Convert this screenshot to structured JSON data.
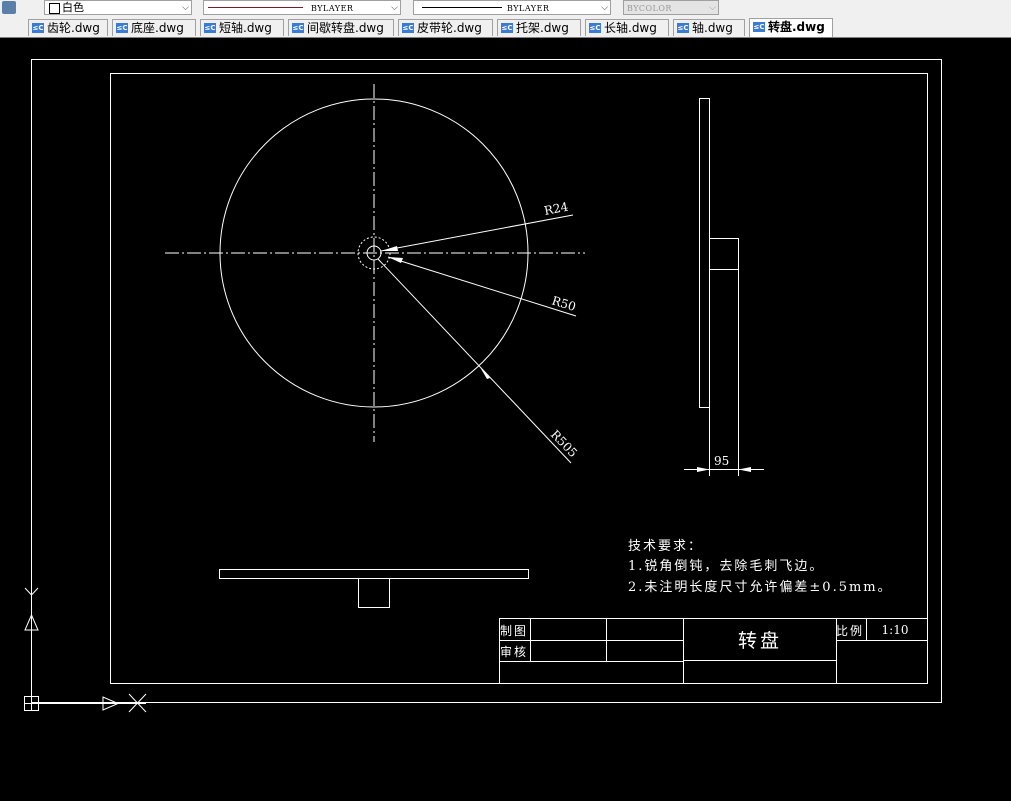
{
  "toolbar": {
    "color_value": "白色",
    "linetype_value": "BYLAYER",
    "lineweight_value": "BYLAYER",
    "plotstyle_value": "BYCOLOR"
  },
  "tabs": [
    {
      "label": "齿轮.dwg"
    },
    {
      "label": "底座.dwg"
    },
    {
      "label": "短轴.dwg"
    },
    {
      "label": "间歇转盘.dwg"
    },
    {
      "label": "皮带轮.dwg"
    },
    {
      "label": "托架.dwg"
    },
    {
      "label": "长轴.dwg"
    },
    {
      "label": "轴.dwg"
    },
    {
      "label": "转盘.dwg",
      "active": true
    }
  ],
  "drawing": {
    "dims": {
      "r24": "R24",
      "r50": "R50",
      "r505": "R505",
      "d95": "95"
    },
    "notes": {
      "title": "技术要求：",
      "line1": "1.锐角倒钝，去除毛刺飞边。",
      "line2": "2.未注明长度尺寸允许偏差±0.5mm。"
    },
    "titleblock": {
      "drawn_by": "制图",
      "checked_by": "审核",
      "part_name": "转盘",
      "scale_label": "比例",
      "scale_value": "1:10"
    }
  },
  "colors": {
    "background": "#000000",
    "lines": "#ffffff"
  }
}
